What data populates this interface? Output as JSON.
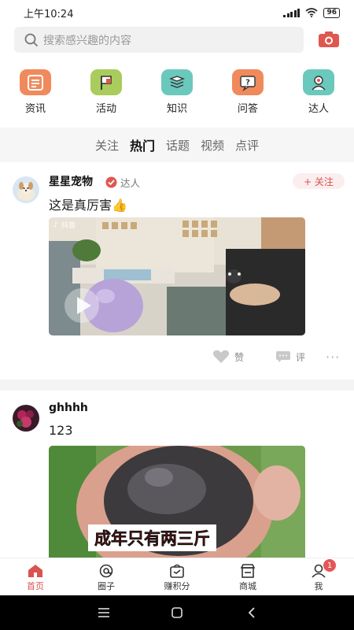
{
  "status": {
    "time": "上午10:24",
    "battery": "96"
  },
  "search": {
    "placeholder": "搜索感兴趣的内容"
  },
  "categories": [
    {
      "label": "资讯",
      "icon": "news-icon",
      "color": "#f08a5d"
    },
    {
      "label": "活动",
      "icon": "flag-icon",
      "color": "#a9cc5c"
    },
    {
      "label": "知识",
      "icon": "book-icon",
      "color": "#6bc8bd"
    },
    {
      "label": "问答",
      "icon": "question-icon",
      "color": "#f08a5d"
    },
    {
      "label": "达人",
      "icon": "expert-icon",
      "color": "#6bc8bd"
    }
  ],
  "tabs": [
    {
      "label": "关注",
      "active": false
    },
    {
      "label": "热门",
      "active": true
    },
    {
      "label": "话题",
      "active": false
    },
    {
      "label": "视频",
      "active": false
    },
    {
      "label": "点评",
      "active": false
    }
  ],
  "posts": [
    {
      "user": "星星宠物",
      "badge": "达人",
      "follow": "+ 关注",
      "text": "这是真厉害👍",
      "video_watermark": "抖音",
      "like": "赞",
      "comment": "评",
      "more": "···"
    },
    {
      "user": "ghhhh",
      "text": "123",
      "image_caption": "成年只有两三斤"
    }
  ],
  "nav": {
    "items": [
      {
        "label": "首页",
        "icon": "home-icon",
        "active": true
      },
      {
        "label": "圈子",
        "icon": "circle-icon",
        "active": false
      },
      {
        "label": "赚积分",
        "icon": "points-bag-icon",
        "active": false
      },
      {
        "label": "商城",
        "icon": "shop-icon",
        "active": false
      },
      {
        "label": "我",
        "icon": "profile-icon",
        "active": false
      }
    ],
    "badge": "1"
  },
  "colors": {
    "accent": "#d9534f",
    "background": "#f4f4f4"
  }
}
